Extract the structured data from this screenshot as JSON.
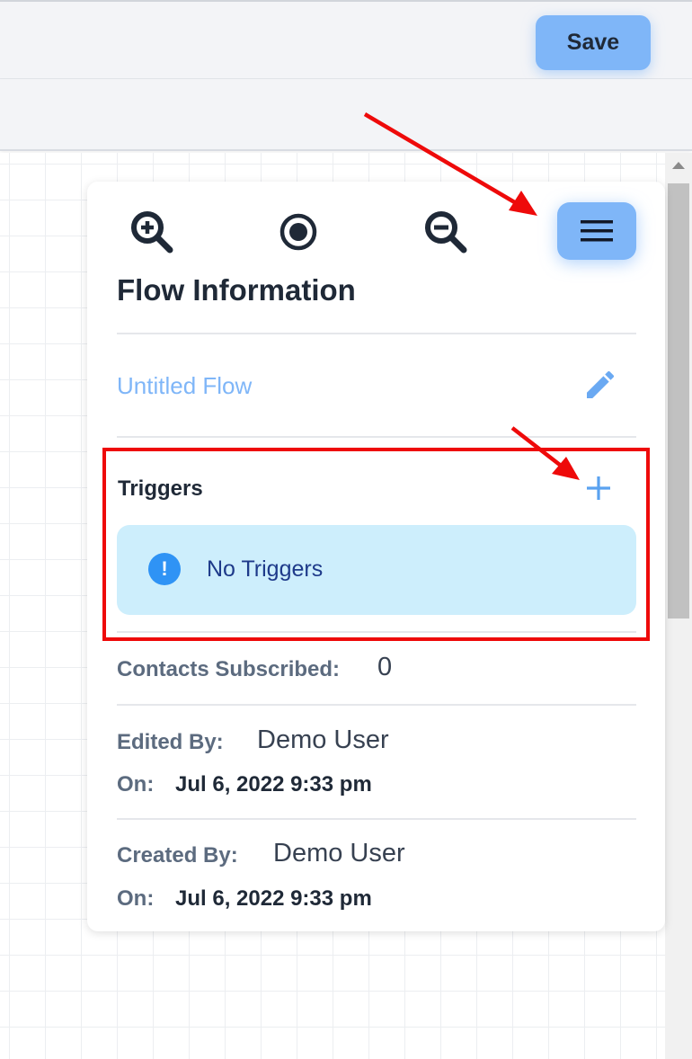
{
  "toolbar": {
    "save_label": "Save"
  },
  "zoom_controls": {
    "zoom_in_icon": "zoom-in-icon",
    "center_icon": "target-icon",
    "zoom_out_icon": "zoom-out-icon",
    "menu_icon": "hamburger-menu-icon"
  },
  "panel": {
    "title": "Flow Information",
    "flow_name": "Untitled Flow",
    "triggers": {
      "label": "Triggers",
      "empty_message": "No Triggers"
    },
    "contacts": {
      "label": "Contacts Subscribed:",
      "value": "0"
    },
    "edited": {
      "label": "Edited By:",
      "user": "Demo User",
      "on_label": "On:",
      "date": "Jul 6, 2022 9:33 pm"
    },
    "created": {
      "label": "Created By:",
      "user": "Demo User",
      "on_label": "On:",
      "date": "Jul 6, 2022 9:33 pm"
    }
  },
  "colors": {
    "accent": "#7fb6f8",
    "alert_bg": "#cdeefc",
    "alert_icon": "#2f93f5",
    "annotation": "#ee0a0a"
  }
}
